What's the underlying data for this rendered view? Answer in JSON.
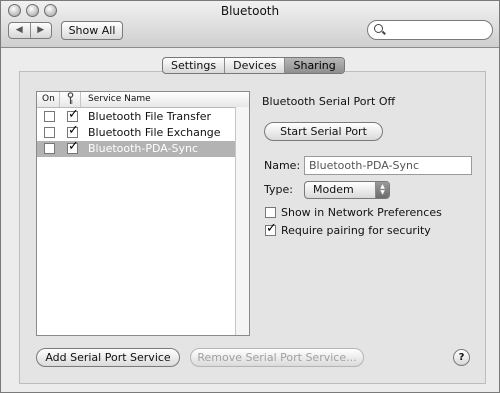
{
  "window": {
    "title": "Bluetooth"
  },
  "toolbar": {
    "back_icon": "◀",
    "forward_icon": "▶",
    "show_all_label": "Show All",
    "search_placeholder": ""
  },
  "tabs": [
    {
      "label": "Settings"
    },
    {
      "label": "Devices"
    },
    {
      "label": "Sharing",
      "selected": true
    }
  ],
  "services": {
    "headers": {
      "on": "On",
      "pairing_icon": "key-icon",
      "name": "Service Name"
    },
    "items": [
      {
        "on": false,
        "pairing": true,
        "name": "Bluetooth File Transfer",
        "selected": false
      },
      {
        "on": false,
        "pairing": true,
        "name": "Bluetooth File Exchange",
        "selected": false
      },
      {
        "on": false,
        "pairing": true,
        "name": "Bluetooth-PDA-Sync",
        "selected": true
      }
    ]
  },
  "detail": {
    "status": "Bluetooth Serial Port Off",
    "start_button": "Start Serial Port",
    "name_label": "Name:",
    "name_value": "Bluetooth-PDA-Sync",
    "type_label": "Type:",
    "type_value": "Modem",
    "show_network_label": "Show in Network Preferences",
    "show_network_checked": false,
    "require_pairing_label": "Require pairing for security",
    "require_pairing_checked": true
  },
  "footer": {
    "add_button": "Add Serial Port Service",
    "remove_button": "Remove Serial Port Service...",
    "help_label": "?"
  }
}
